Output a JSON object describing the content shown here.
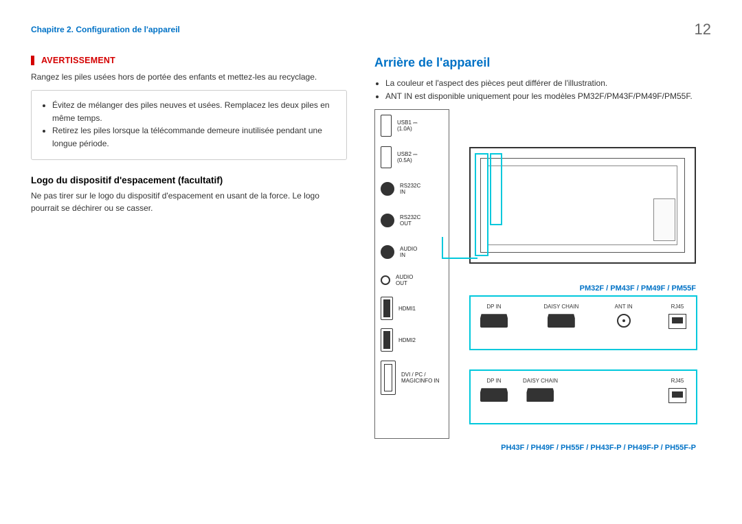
{
  "header": {
    "chapter": "Chapitre 2. Configuration de l'appareil",
    "page_number": "12"
  },
  "left": {
    "warning_title": "AVERTISSEMENT",
    "warning_text": "Rangez les piles usées hors de portée des enfants et mettez-les au recyclage.",
    "bullets": [
      "Évitez de mélanger des piles neuves et usées. Remplacez les deux piles en même temps.",
      "Retirez les piles lorsque la télécommande demeure inutilisée pendant une longue période."
    ],
    "sub_heading": "Logo du dispositif d'espacement (facultatif)",
    "sub_text": "Ne pas tirer sur le logo du dispositif d'espacement en usant de la force. Le logo pourrait se déchirer ou se casser."
  },
  "right": {
    "heading": "Arrière de l'appareil",
    "bullets": [
      "La couleur et l'aspect des pièces peut différer de l'illustration.",
      "ANT IN est disponible uniquement pour les modèles PM32F/PM43F/PM49F/PM55F."
    ],
    "ports_vertical": [
      {
        "name": "usb1",
        "label": "USB1 ⎓\n(1.0A)",
        "shape": "usb"
      },
      {
        "name": "usb2",
        "label": "USB2 ⎓\n(0.5A)",
        "shape": "usb"
      },
      {
        "name": "rs232c-in",
        "label": "RS232C\nIN",
        "shape": "circle"
      },
      {
        "name": "rs232c-out",
        "label": "RS232C\nOUT",
        "shape": "circle"
      },
      {
        "name": "audio-in",
        "label": "AUDIO\nIN",
        "shape": "circle"
      },
      {
        "name": "audio-out",
        "label": "AUDIO\nOUT",
        "shape": "audio-hole"
      },
      {
        "name": "hdmi1",
        "label": "HDMI1",
        "shape": "hdmi"
      },
      {
        "name": "hdmi2",
        "label": "HDMI2",
        "shape": "hdmi"
      },
      {
        "name": "dvi",
        "label": "DVI / PC /\nMAGICINFO IN",
        "shape": "dvi"
      }
    ],
    "product_label_top": "PM32F / PM43F / PM49F / PM55F",
    "io_top": [
      {
        "name": "dp-in",
        "label": "DP IN",
        "shape": "dp"
      },
      {
        "name": "daisy-chain",
        "label": "DAISY CHAIN",
        "shape": "dp"
      },
      {
        "name": "ant-in",
        "label": "ANT IN",
        "shape": "antin"
      },
      {
        "name": "rj45",
        "label": "RJ45",
        "shape": "rj45"
      }
    ],
    "io_bottom": [
      {
        "name": "dp-in",
        "label": "DP IN",
        "shape": "dp"
      },
      {
        "name": "daisy-chain",
        "label": "DAISY CHAIN",
        "shape": "dp"
      },
      {
        "name": "rj45",
        "label": "RJ45",
        "shape": "rj45"
      }
    ],
    "product_label_bottom": "PH43F / PH49F / PH55F / PH43F-P / PH49F-P / PH55F-P"
  }
}
